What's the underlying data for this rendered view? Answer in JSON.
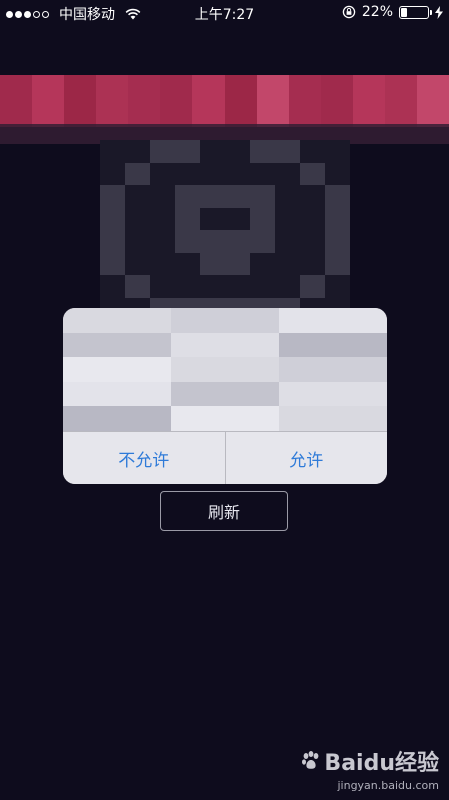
{
  "status_bar": {
    "carrier": "中国移动",
    "time": "上午7:27",
    "battery_percent": "22%",
    "battery_level": 0.22,
    "signal_bars_filled": 3,
    "signal_bars_total": 5
  },
  "dialog": {
    "deny_label": "不允许",
    "allow_label": "允许"
  },
  "refresh_label": "刷新",
  "watermark": {
    "brand": "Baidu经验",
    "url": "jingyan.baidu.com"
  },
  "colors": {
    "background": "#0e0c1d",
    "accent_blue": "#2e7ad8",
    "banner_red": "#a02a4c"
  },
  "icons": [
    "wifi-icon",
    "rotation-lock-icon",
    "battery-icon",
    "charging-bolt-icon",
    "baidu-paw-icon",
    "lock-icon"
  ]
}
